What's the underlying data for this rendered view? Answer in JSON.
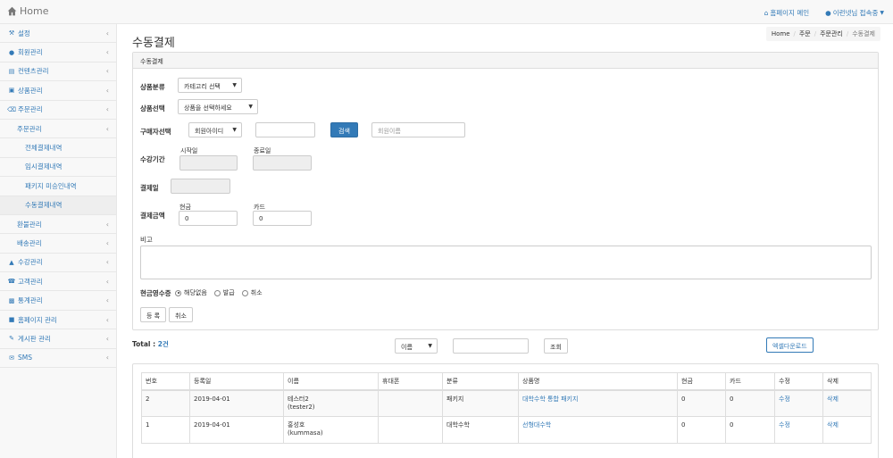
{
  "topbar": {
    "brand": "Home",
    "homepage_main": "홈페이지 메인",
    "user_status": "이런넷님 접속중"
  },
  "sidebar": {
    "items": [
      {
        "label": "설정",
        "icon": "wrench-icon"
      },
      {
        "label": "회원관리",
        "icon": "user-icon"
      },
      {
        "label": "컨텐츠관리",
        "icon": "film-icon"
      },
      {
        "label": "상품관리",
        "icon": "gift-icon"
      },
      {
        "label": "주문관리",
        "icon": "cart-icon"
      },
      {
        "label": "주문관리"
      },
      {
        "label": "전체결제내역"
      },
      {
        "label": "임시결제내역"
      },
      {
        "label": "패키지 미승인내역"
      },
      {
        "label": "수동결제내역"
      },
      {
        "label": "환불관리"
      },
      {
        "label": "배송관리"
      },
      {
        "label": "수강관리",
        "icon": "graduation-cap-icon"
      },
      {
        "label": "고객관리",
        "icon": "phone-icon"
      },
      {
        "label": "통계관리",
        "icon": "bar-chart-icon"
      },
      {
        "label": "홈페이지 관리",
        "icon": "car-icon"
      },
      {
        "label": "게시판 관리",
        "icon": "edit-icon"
      },
      {
        "label": "SMS",
        "icon": "envelope-icon"
      }
    ]
  },
  "page": {
    "title": "수동결제",
    "breadcrumb": [
      "Home",
      "주문",
      "주문관리",
      "수동결제"
    ]
  },
  "form": {
    "panel_title": "수동결제",
    "category_label": "상품분류",
    "category_value": "카테고리 선택",
    "product_label": "상품선택",
    "product_value": "상품을 선택하세요",
    "buyer_label": "구매자선택",
    "buyer_type_value": "회원아이디",
    "buyer_input_value": "",
    "search_button": "검색",
    "member_name_placeholder": "회원이름",
    "period_label": "수강기간",
    "start_label": "시작일",
    "end_label": "종료일",
    "paydate_label": "결제일",
    "amount_label": "결제금액",
    "cash_label": "현금",
    "cash_value": "0",
    "card_label": "카드",
    "card_value": "0",
    "note_label": "비고",
    "receipt_label": "현금영수증",
    "receipt_options": [
      "해당없음",
      "발급",
      "취소"
    ],
    "receipt_selected": "해당없음",
    "register_button": "등 록",
    "cancel_button": "취소"
  },
  "list": {
    "total_prefix": "Total : ",
    "total_count": "2건",
    "filter_value": "이름",
    "query_value": "",
    "query_button": "조회",
    "excel_button": "엑셀다운로드",
    "columns": [
      "번호",
      "등록일",
      "이름",
      "휴대폰",
      "분류",
      "상품명",
      "현금",
      "카드",
      "수정",
      "삭제"
    ],
    "rows": [
      {
        "no": "2",
        "date": "2019-04-01",
        "name": "테스터2",
        "id": "(tester2)",
        "phone": "",
        "category": "패키지",
        "product": "대학수학 통합 패키지",
        "cash": "0",
        "card": "0",
        "edit": "수정",
        "delete": "삭제"
      },
      {
        "no": "1",
        "date": "2019-04-01",
        "name": "홍성호",
        "id": "(kummasa)",
        "phone": "",
        "category": "대학수학",
        "product": "선형대수학",
        "cash": "0",
        "card": "0",
        "edit": "수정",
        "delete": "삭제"
      }
    ]
  },
  "colors": {
    "accent": "#337ab7",
    "sidebar_bg": "#f8f8f8",
    "border": "#dddddd"
  }
}
